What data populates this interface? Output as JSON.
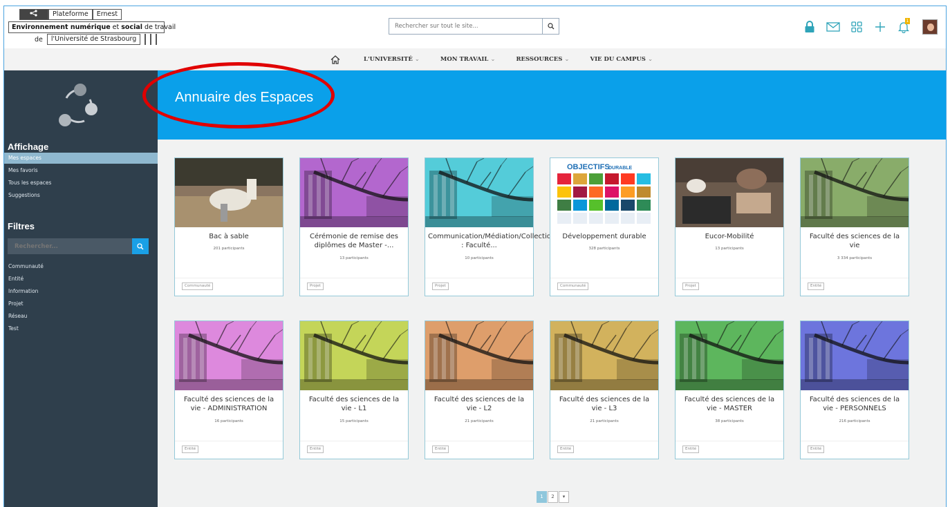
{
  "header": {
    "logo": {
      "line1_part1": "Plateforme",
      "line1_part2": "Ernest",
      "line2_bold1": "Environnement numérique",
      "line2_mid": " et ",
      "line2_bold2": "social",
      "line2_end": " de travail",
      "line3_de": "de",
      "line3_univ": "l'Université de Strasbourg"
    },
    "search": {
      "placeholder": "Rechercher sur tout le site..."
    },
    "icons": [
      "lock-icon",
      "mail-icon",
      "apps-grid-icon",
      "plus-icon",
      "bell-icon"
    ],
    "notification_badge": "1"
  },
  "nav": {
    "items": [
      {
        "label": "L'UNIVERSITÉ"
      },
      {
        "label": "MON TRAVAIL"
      },
      {
        "label": "RESSOURCES"
      },
      {
        "label": "VIE DU CAMPUS"
      }
    ]
  },
  "sidebar": {
    "affichage_heading": "Affichage",
    "affichage_items": [
      "Mes espaces",
      "Mes favoris",
      "Tous les espaces",
      "Suggestions"
    ],
    "filtres_heading": "Filtres",
    "search_placeholder": "Rechercher...",
    "filter_items": [
      "Communauté",
      "Entité",
      "Information",
      "Projet",
      "Réseau",
      "Test"
    ]
  },
  "banner": {
    "title": "Annuaire des Espaces"
  },
  "cards": [
    {
      "title": "Bac à sable",
      "participants": "201 participants",
      "tag": "Communauté",
      "thumb": "sandbox"
    },
    {
      "title": "Cérémonie de remise des diplômes de Master -...",
      "participants": "13 participants",
      "tag": "Projet",
      "thumb": "#a346c4"
    },
    {
      "title": "Communication/Médiation/Collections : Faculté...",
      "participants": "10 participants",
      "tag": "Projet",
      "thumb": "#2fc1d1"
    },
    {
      "title": "Développement durable",
      "participants": "328 participants",
      "tag": "Communauté",
      "thumb": "sdg"
    },
    {
      "title": "Eucor-Mobilité",
      "participants": "13 participants",
      "tag": "Projet",
      "thumb": "desk"
    },
    {
      "title": "Faculté des sciences de la vie",
      "participants": "3 334 participants",
      "tag": "Entité",
      "thumb": "#6f9a4a"
    },
    {
      "title": "Faculté des sciences de la vie - ADMINISTRATION",
      "participants": "16 participants",
      "tag": "Entité",
      "thumb": "#d66fd6"
    },
    {
      "title": "Faculté des sciences de la vie - L1",
      "participants": "15 participants",
      "tag": "Entité",
      "thumb": "#b7cc35"
    },
    {
      "title": "Faculté des sciences de la vie - L2",
      "participants": "21 participants",
      "tag": "Entité",
      "thumb": "#d7894b"
    },
    {
      "title": "Faculté des sciences de la vie - L3",
      "participants": "21 participants",
      "tag": "Entité",
      "thumb": "#c9a13a"
    },
    {
      "title": "Faculté des sciences de la vie - MASTER",
      "participants": "38 participants",
      "tag": "Entité",
      "thumb": "#3aa63a"
    },
    {
      "title": "Faculté des sciences de la vie - PERSONNELS",
      "participants": "216 participants",
      "tag": "Entité",
      "thumb": "#4e57d6"
    }
  ],
  "pagination": {
    "pages": [
      "1",
      "2"
    ],
    "current": "1",
    "more": "▾"
  },
  "colors": {
    "accent": "#0aa0ea",
    "sidebar": "#2f3f4c",
    "highlight": "#e00000"
  }
}
